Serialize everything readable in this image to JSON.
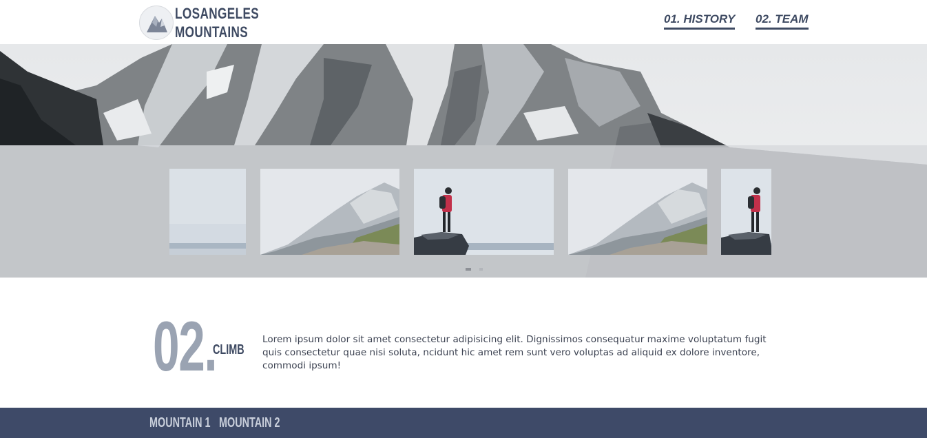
{
  "brand": {
    "line1": "LOSANGELES",
    "line2": "MOUNTAINS",
    "icon": "mountain-logo-icon"
  },
  "nav": [
    {
      "label": "01. HISTORY"
    },
    {
      "label": "02. TEAM"
    }
  ],
  "carousel": {
    "slides": [
      {
        "subject": "foggy-sky"
      },
      {
        "subject": "misty-mountain"
      },
      {
        "subject": "hiker-on-rock"
      },
      {
        "subject": "misty-mountain"
      },
      {
        "subject": "hiker-on-rock"
      }
    ],
    "dots": 2,
    "active_dot": 0
  },
  "section": {
    "number": "02.",
    "title": "CLIMB",
    "text": "Lorem ipsum dolor sit amet consectetur adipisicing elit. Dignissimos consequatur maxime voluptatum fugit quis consectetur quae nisi soluta, ncidunt hic amet rem sunt vero voluptas ad aliquid ex dolore inventore, commodi ipsum!"
  },
  "footer": {
    "links": [
      {
        "label": "MOUNTAIN 1"
      },
      {
        "label": "MOUNTAIN 2"
      }
    ]
  },
  "colors": {
    "accent": "#3e4a62",
    "footer_bg": "#3e4a68",
    "number": "#9aa3b2"
  }
}
